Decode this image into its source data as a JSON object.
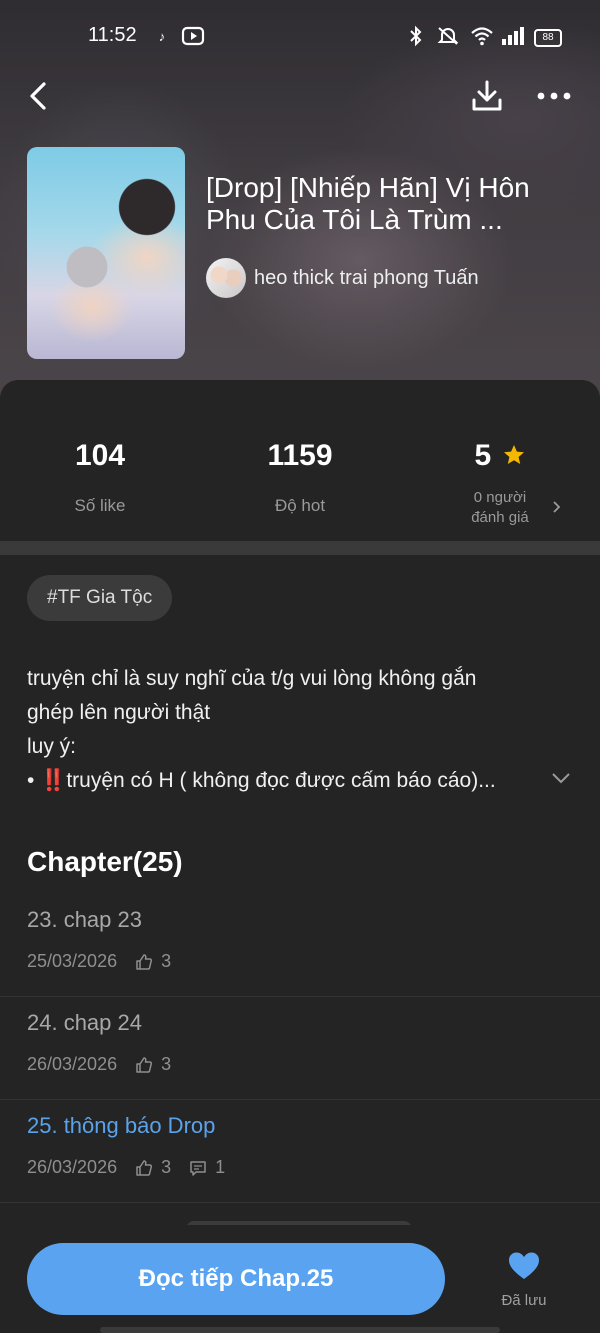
{
  "status_bar": {
    "time": "11:52",
    "battery": "88",
    "icons": [
      "tiktok-icon",
      "youtube-icon",
      "bluetooth-icon",
      "mute-icon",
      "wifi-icon",
      "signal-icon"
    ]
  },
  "story": {
    "title": "[Drop] [Nhiếp Hãn] Vị Hôn Phu Của Tôi Là Trùm ...",
    "author": "heo thick trai phong Tuấn"
  },
  "stats": {
    "likes": {
      "value": "104",
      "label": "Số like"
    },
    "hot": {
      "value": "1159",
      "label": "Độ hot"
    },
    "rating": {
      "value": "5",
      "label_line1": "0 người",
      "label_line2": "đánh giá"
    }
  },
  "tag": "#TF Gia Tộc",
  "description": {
    "line1": "truyện chỉ là suy nghĩ của t/g vui lòng không gắn",
    "line2": "ghép lên người thật",
    "line3": "luy ý:",
    "line4": "• ‼️truyện có H ( không đọc được cấm báo cáo)..."
  },
  "chapters": {
    "heading": "Chapter(25)",
    "items": [
      {
        "title": "23. chap 23",
        "date": "25/03/2026",
        "likes": "3"
      },
      {
        "title": "24. chap 24",
        "date": "26/03/2026",
        "likes": "3"
      },
      {
        "title": "25. thông báo Drop",
        "date": "26/03/2026",
        "likes": "3",
        "comments": "1"
      }
    ]
  },
  "bottom": {
    "read_button": "Đọc tiếp Chap.25",
    "saved_label": "Đã lưu"
  },
  "colors": {
    "accent": "#5aa3f0",
    "star": "#f5b800",
    "background": "#242424"
  }
}
